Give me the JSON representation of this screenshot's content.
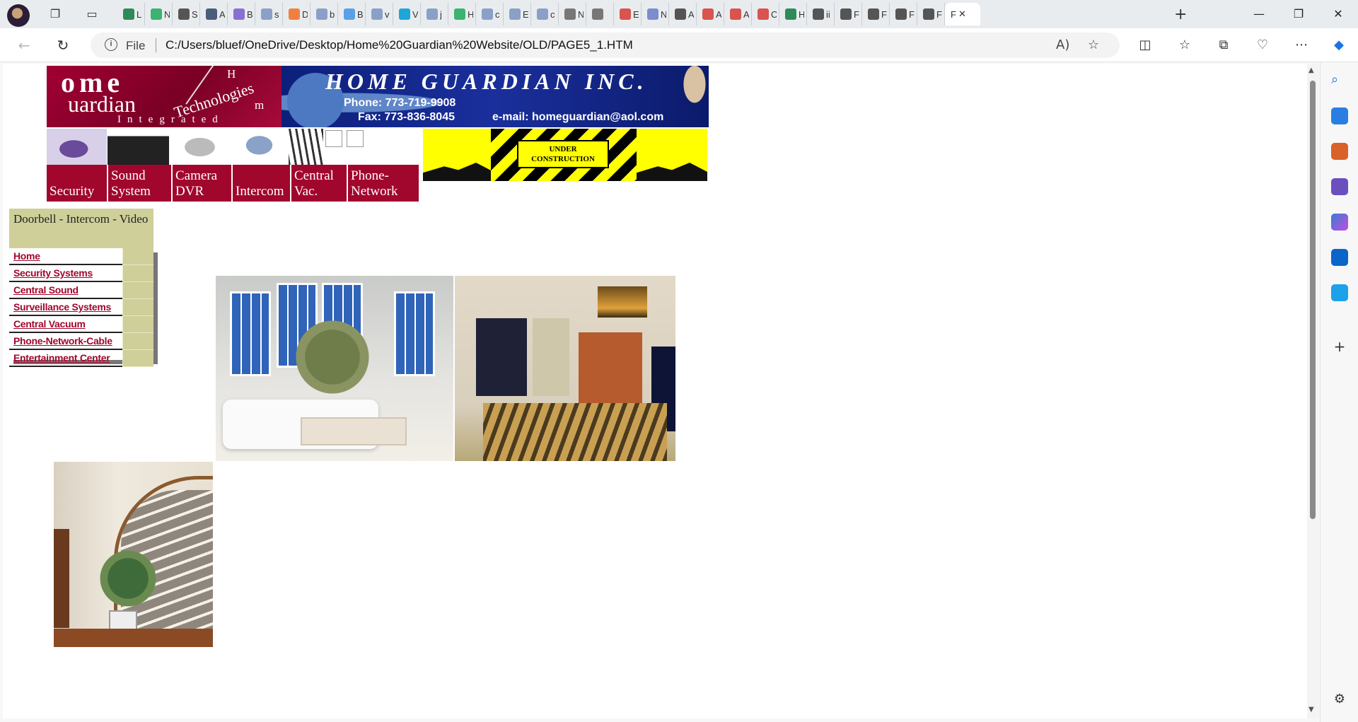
{
  "browser": {
    "tabs": [
      {
        "label": "L",
        "color": "#2e8b57"
      },
      {
        "label": "N",
        "color": "#3cb371"
      },
      {
        "label": "S",
        "color": "#555555"
      },
      {
        "label": "A",
        "color": "#4a5d7a"
      },
      {
        "label": "B",
        "color": "#8a6fd1"
      },
      {
        "label": "s",
        "color": "#8aa0c8"
      },
      {
        "label": "D",
        "color": "#f08040"
      },
      {
        "label": "b",
        "color": "#8aa0c8"
      },
      {
        "label": "B",
        "color": "#5aa0e6"
      },
      {
        "label": "v",
        "color": "#8aa0c8"
      },
      {
        "label": "V",
        "color": "#1ea7d6"
      },
      {
        "label": "j",
        "color": "#8aa0c8"
      },
      {
        "label": "H",
        "color": "#3cb371"
      },
      {
        "label": "c",
        "color": "#8aa0c8"
      },
      {
        "label": "E",
        "color": "#8aa0c8"
      },
      {
        "label": "c",
        "color": "#8aa0c8"
      },
      {
        "label": "N",
        "color": "#777777"
      },
      {
        "label": "",
        "color": "#777777"
      },
      {
        "label": "E",
        "color": "#d9534f"
      },
      {
        "label": "N",
        "color": "#7b8ccf"
      },
      {
        "label": "A",
        "color": "#555555"
      },
      {
        "label": "A",
        "color": "#d9534f"
      },
      {
        "label": "A",
        "color": "#d9534f"
      },
      {
        "label": "C",
        "color": "#d9534f"
      },
      {
        "label": "H",
        "color": "#2e8b57"
      },
      {
        "label": "ii",
        "color": "#555555"
      },
      {
        "label": "F",
        "color": "#555555"
      },
      {
        "label": "F",
        "color": "#555555"
      },
      {
        "label": "F",
        "color": "#555555"
      },
      {
        "label": "F",
        "color": "#555555"
      }
    ],
    "active_tab": {
      "label": "F"
    },
    "address": {
      "scheme_label": "File",
      "url": "C:/Users/bluef/OneDrive/Desktop/Home%20Guardian%20Website/OLD/PAGE5_1.HTM"
    }
  },
  "page": {
    "logo": {
      "home": "ome",
      "guardian": "uardian",
      "integrated": "Integrated",
      "technologies": "Technologies",
      "h": "H",
      "m": "m"
    },
    "banner": {
      "company": "HOME GUARDIAN INC.",
      "phone": "Phone: 773-719-9908",
      "fax": "Fax: 773-836-8045",
      "email": "e-mail: homeguardian@aol.com"
    },
    "top_nav": [
      "Security",
      "Sound System",
      "Camera DVR",
      "Intercom",
      "Central Vac.",
      "Phone-Network"
    ],
    "construction": {
      "text": "UNDER CONSTRUCTION"
    },
    "section_title": "Doorbell - Intercom - Video",
    "side_menu": [
      "Home",
      "Security Systems",
      "Central Sound",
      "Surveillance Systems",
      "Central Vacuum",
      "Phone-Network-Cable",
      "Entertainment Center"
    ]
  },
  "colors": {
    "nav_red": "#a1062d",
    "menu_khaki": "#cfcf9a",
    "banner_blue": "#0c1f7a",
    "construction_yellow": "#ffff00"
  }
}
